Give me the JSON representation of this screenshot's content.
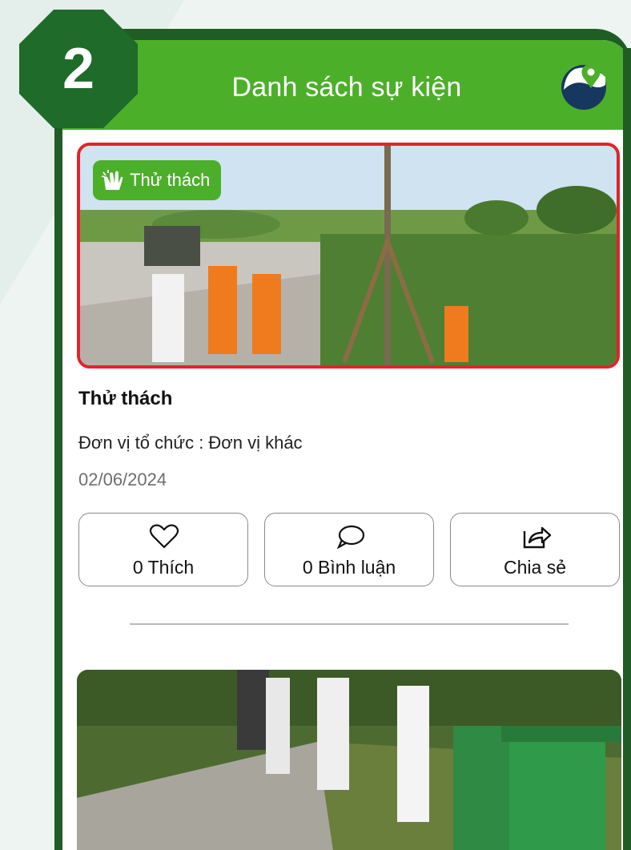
{
  "step_badge": {
    "number": "2"
  },
  "header": {
    "title": "Danh sách sự kiện",
    "logo_icon": "location-pin-logo-icon"
  },
  "colors": {
    "header_green": "#4caf2a",
    "frame_dark_green": "#1f5d24",
    "highlight_red": "#e0242c"
  },
  "events": [
    {
      "tag": "Thử thách",
      "tag_icon": "clapping-hands-icon",
      "title": "Thử thách",
      "organizer": "Đơn vị tổ chức : Đơn vị khác",
      "date": "02/06/2024",
      "actions": {
        "like": {
          "label": "0 Thích",
          "icon": "heart-icon"
        },
        "comment": {
          "label": "0 Bình luận",
          "icon": "speech-bubble-icon"
        },
        "share": {
          "label": "Chia sẻ",
          "icon": "share-arrow-icon"
        }
      }
    }
  ]
}
